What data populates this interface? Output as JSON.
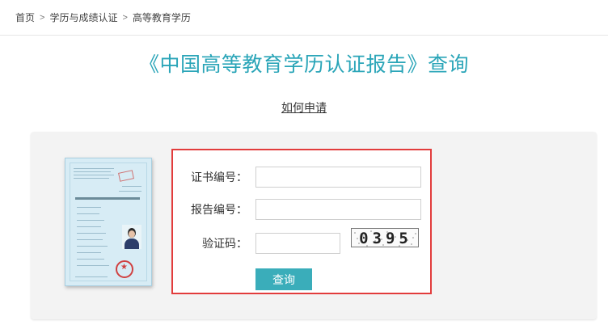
{
  "breadcrumb": {
    "items": [
      "首页",
      "学历与成绩认证",
      "高等教育学历"
    ],
    "separator": ">"
  },
  "page": {
    "title": "《中国高等教育学历认证报告》查询",
    "apply_link": "如何申请"
  },
  "form": {
    "cert_no_label": "证书编号：",
    "cert_no_value": "",
    "report_no_label": "报告编号：",
    "report_no_value": "",
    "captcha_label": "验证码：",
    "captcha_value": "",
    "captcha_text": "0395",
    "submit_label": "查询"
  },
  "colors": {
    "accent": "#3aadba",
    "title": "#2aa5b8",
    "highlight_border": "#e23c3c",
    "panel_bg": "#f3f3f3"
  }
}
